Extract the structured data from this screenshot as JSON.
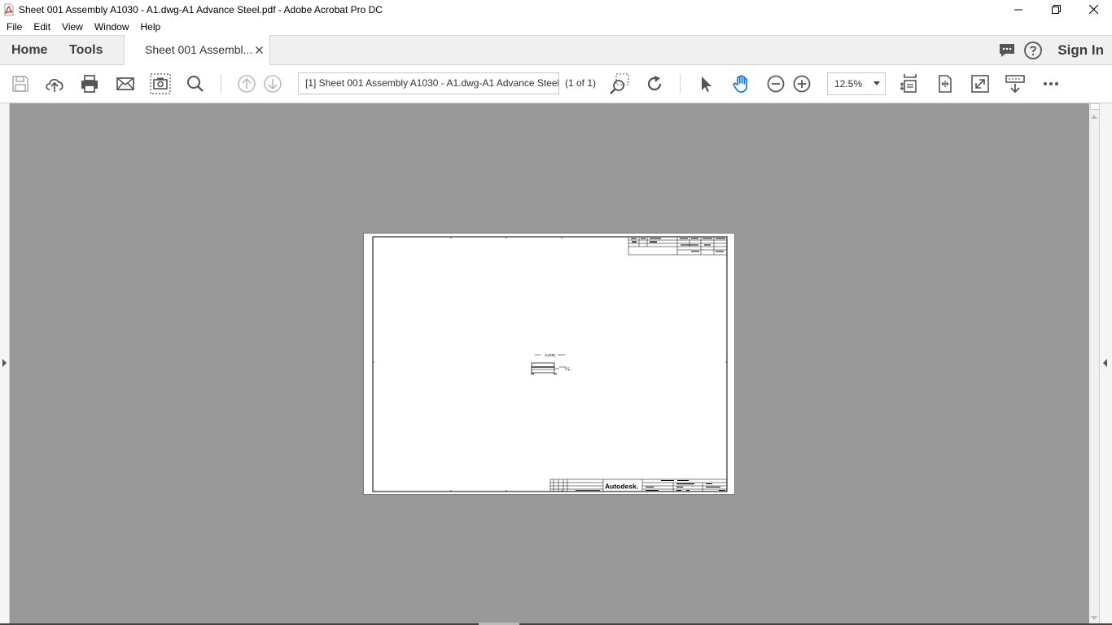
{
  "window": {
    "title": "Sheet 001 Assembly A1030 - A1.dwg-A1 Advance Steel.pdf - Adobe Acrobat Pro DC",
    "icon": "pdf-icon"
  },
  "menu": {
    "items": [
      "File",
      "Edit",
      "View",
      "Window",
      "Help"
    ]
  },
  "tabs": {
    "home": "Home",
    "tools": "Tools",
    "document": "Sheet 001 Assembl...",
    "sign_in": "Sign In"
  },
  "toolbar": {
    "doc_name": "[1] Sheet 001 Assembly A1030 - A1.dwg-A1 Advance Steel",
    "page_count": "(1 of 1)",
    "zoom": "12.5%"
  },
  "drawing": {
    "assembly_mark": "A1030",
    "brand": "Autodesk."
  },
  "colors": {
    "doc_background": "#999999",
    "toolbar_icon": "#555555",
    "pdf_red": "#d21e1e",
    "hand_tool_blue": "#1473e6"
  }
}
